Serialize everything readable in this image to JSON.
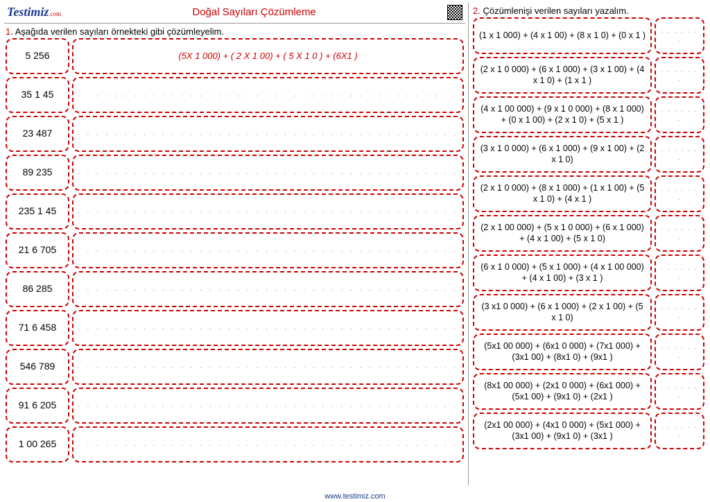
{
  "brand": {
    "name": "Testimiz",
    "suffix": ".com"
  },
  "title": "Doğal Sayıları Çözümleme",
  "q1": {
    "num": "1",
    "text": ". Aşağıda verilen sayıları örnekteki gibi çözümleyelim.",
    "rows": [
      {
        "n": "5 256",
        "expansion": "(5X 1 000) + ( 2 X 1 00) + ( 5 X 1 0 ) + (6X1 )"
      },
      {
        "n": "35 1 45",
        "expansion": ""
      },
      {
        "n": "23 487",
        "expansion": ""
      },
      {
        "n": "89 235",
        "expansion": ""
      },
      {
        "n": "235 1 45",
        "expansion": ""
      },
      {
        "n": "21 6 705",
        "expansion": ""
      },
      {
        "n": "86 285",
        "expansion": ""
      },
      {
        "n": "71 6 458",
        "expansion": ""
      },
      {
        "n": "546 789",
        "expansion": ""
      },
      {
        "n": "91 6 205",
        "expansion": ""
      },
      {
        "n": "1 00 265",
        "expansion": ""
      }
    ]
  },
  "q2": {
    "num": "2",
    "text": ". Çözümlenişi verilen sayıları yazalım.",
    "rows": [
      "(1 x 1 000) + (4 x 1 00) + (8 x 1 0) + (0 x 1 )",
      "(2 x 1 0 000) + (6 x 1 000) + (3 x 1 00) + (4 x 1 0) + (1 x 1 )",
      "(4 x 1 00 000) + (9 x 1 0 000) + (8 x 1 000) + (0 x 1 00) + (2 x 1 0) + (5 x 1 )",
      "(3 x 1 0 000) + (6 x 1 000) + (9 x 1 00) + (2 x 1 0)",
      "(2 x 1 0 000) + (8 x 1 000) + (1 x 1 00) + (5 x 1 0) + (4 x 1 )",
      "(2 x 1 00 000) + (5 x 1 0 000) + (6 x 1 000) + (4 x 1 00) + (5 x 1 0)",
      "(6 x 1 0 000) + (5 x 1 000) + (4 x 1 00 000) + (4 x 1 00) + (3 x 1 )",
      "(3 x1 0 000) + (6 x 1 000) + (2 x 1 00) + (5 x 1 0)",
      "(5x1 00 000) + (6x1 0 000) + (7x1 000) + (3x1 00) + (8x1 0) + (9x1 )",
      "(8x1 00 000) + (2x1 0 000) + (6x1 000) + (5x1 00) + (9x1 0) + (2x1 )",
      "(2x1 00 000) + (4x1 0 000) + (5x1 000) + (3x1 00) + (9x1 0) + (3x1 )"
    ]
  },
  "dots": ". . . . . . . . . . . . . . . . . . . . . . . . . . . . . . . . . . . . . . . . .",
  "shortdots": ". . . . . . .",
  "footer": "www.testimiz.com"
}
